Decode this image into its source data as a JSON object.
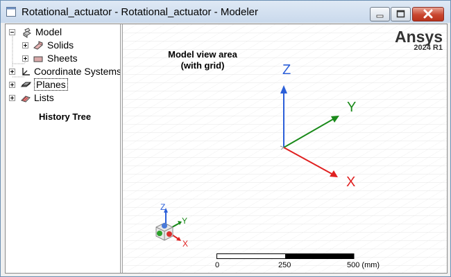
{
  "window": {
    "title": "Rotational_actuator - Rotational_actuator - Modeler"
  },
  "tree": {
    "nodes": [
      {
        "label": "Model"
      },
      {
        "label": "Solids"
      },
      {
        "label": "Sheets"
      },
      {
        "label": "Coordinate Systems"
      },
      {
        "label": "Planes"
      },
      {
        "label": "Lists"
      }
    ],
    "caption": "History Tree"
  },
  "viewport": {
    "caption_line1": "Model view area",
    "caption_line2": "(with grid)",
    "brand": "Ansys",
    "version": "2024 R1",
    "axes": {
      "x": "X",
      "y": "Y",
      "z": "Z"
    },
    "axis_colors": {
      "x": "#e02020",
      "y": "#1a8a1a",
      "z": "#2b5fd9"
    },
    "scale": {
      "start": "0",
      "mid": "250",
      "end": "500 (mm)"
    }
  }
}
